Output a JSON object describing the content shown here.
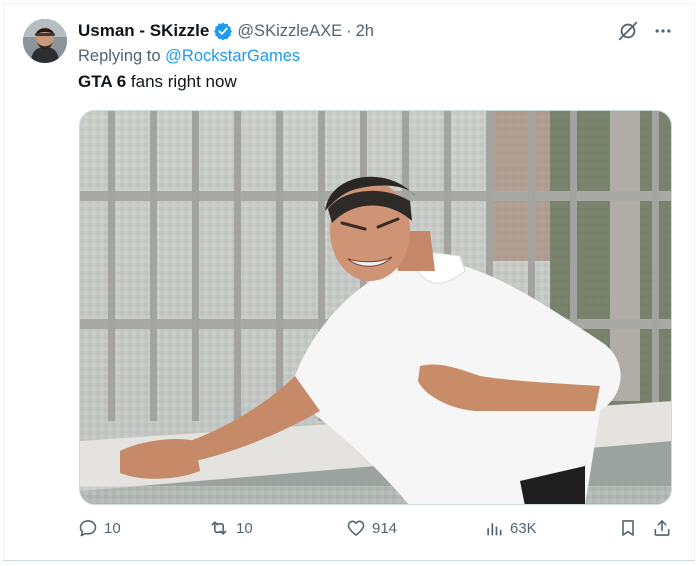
{
  "tweet": {
    "display_name": "Usman - SKizzle",
    "verified": true,
    "handle": "@SKizzleAXE",
    "separator": "·",
    "time": "2h",
    "reply_prefix": "Replying to",
    "reply_to": "@RockstarGames",
    "text_bold": "GTA 6",
    "text_rest": " fans right now"
  },
  "actions": {
    "replies": "10",
    "reposts": "10",
    "likes": "914",
    "views": "63K"
  },
  "colors": {
    "accent": "#1d9bf0",
    "secondary_text": "#536471",
    "primary_text": "#0f1419"
  },
  "icons": [
    "verified-icon",
    "grok-icon",
    "more-icon",
    "reply-icon",
    "repost-icon",
    "like-icon",
    "views-icon",
    "bookmark-icon",
    "share-icon"
  ]
}
